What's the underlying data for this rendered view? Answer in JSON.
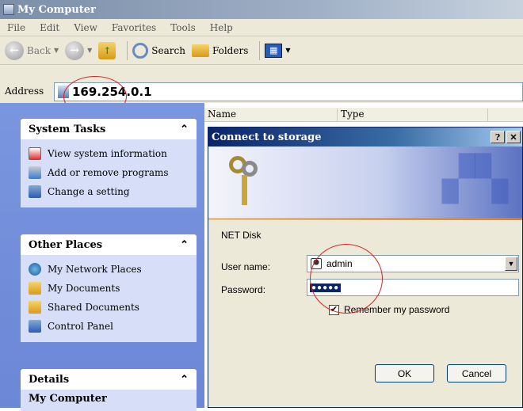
{
  "window": {
    "title": "My Computer"
  },
  "menu": [
    "File",
    "Edit",
    "View",
    "Favorites",
    "Tools",
    "Help"
  ],
  "toolbar": {
    "back": "Back",
    "search": "Search",
    "folders": "Folders"
  },
  "address": {
    "label": "Address",
    "value": "169.254.0.1"
  },
  "list_columns": [
    "Name",
    "Type"
  ],
  "system_tasks": {
    "title": "System Tasks",
    "items": [
      "View system information",
      "Add or remove programs",
      "Change a setting"
    ]
  },
  "other_places": {
    "title": "Other Places",
    "items": [
      "My Network Places",
      "My Documents",
      "Shared Documents",
      "Control Panel"
    ]
  },
  "details": {
    "title": "Details",
    "name": "My Computer"
  },
  "dialog": {
    "title": "Connect to storage",
    "site": "NET Disk",
    "username_label": "User name:",
    "username_value": "admin",
    "password_label": "Password:",
    "password_masked": "●●●●●",
    "remember_label": "Remember my password",
    "remember_checked": true,
    "ok": "OK",
    "cancel": "Cancel"
  },
  "colors": {
    "highlight_circle": "#dd2222",
    "title_blue": "#0a246a",
    "pane_blue": "#6b87d6"
  }
}
